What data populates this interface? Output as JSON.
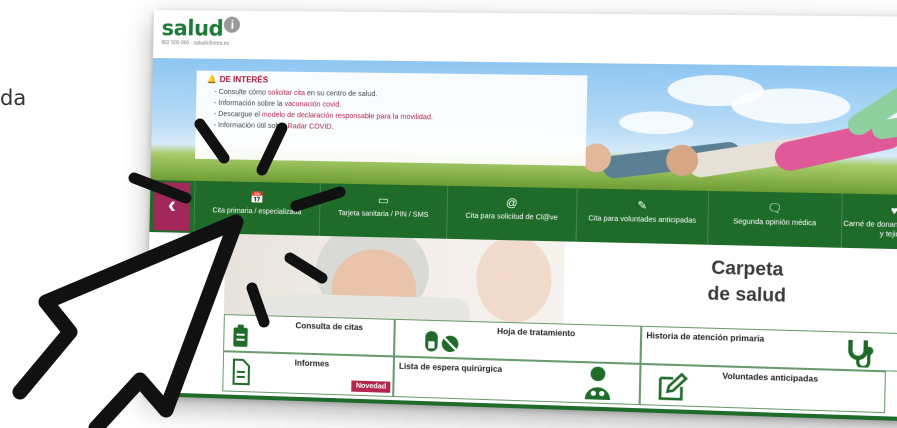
{
  "left_text": "da",
  "header": {
    "logo_text": "salud",
    "logo_badge": "i",
    "logo_tagline": "902 505 060 · saludinforma.es"
  },
  "notice": {
    "title": "DE INTERÉS",
    "items": [
      {
        "pre": "- Consulte cómo ",
        "link": "solicitar cita",
        "post": " en su centro de salud."
      },
      {
        "pre": "- Información sobre la ",
        "link": "vacunación covid",
        "post": "."
      },
      {
        "pre": "- Descargue el ",
        "link": "modelo de declaración responsable para la movilidad",
        "post": "."
      },
      {
        "pre": "- Información útil sobre ",
        "link": "Radar COVID",
        "post": "."
      }
    ]
  },
  "nav": {
    "back_label": "‹",
    "items": [
      {
        "icon": "📅",
        "label": "Cita primaria / especializada"
      },
      {
        "icon": "▭",
        "label": "Tarjeta sanitaria / PIN / SMS"
      },
      {
        "icon": "@",
        "label": "Cita para solicitud de Cl@ve"
      },
      {
        "icon": "✎",
        "label": "Cita para voluntades anticipadas"
      },
      {
        "icon": "🗨",
        "label": "Segunda opinión médica"
      },
      {
        "icon": "♥",
        "label": "Carné de donante de órganos y tejidos"
      }
    ]
  },
  "content": {
    "carpeta_line1": "Carpeta",
    "carpeta_line2": "de salud",
    "tiles": {
      "consulta": "Consulta de citas",
      "hoja": "Hoja de tratamiento",
      "historia": "Historia de atención primaria",
      "informes": "Informes",
      "informes_badge": "Novedad",
      "lista": "Lista de espera quirúrgica",
      "voluntades": "Voluntades anticipadas"
    }
  },
  "colors": {
    "brand_green": "#1e6b2a",
    "accent_magenta": "#a2285a",
    "notice_red": "#a2163d"
  }
}
